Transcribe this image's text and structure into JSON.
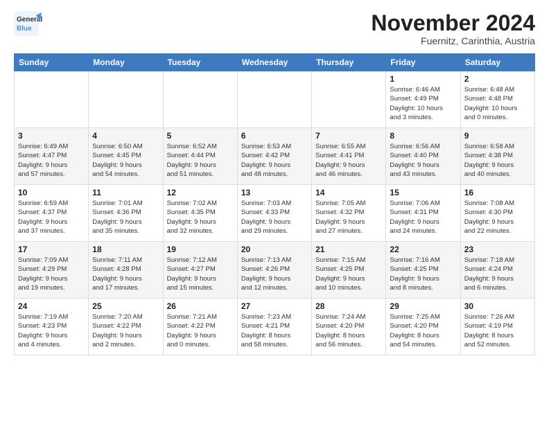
{
  "logo": {
    "text_general": "General",
    "text_blue": "Blue"
  },
  "header": {
    "month": "November 2024",
    "location": "Fuernitz, Carinthia, Austria"
  },
  "weekdays": [
    "Sunday",
    "Monday",
    "Tuesday",
    "Wednesday",
    "Thursday",
    "Friday",
    "Saturday"
  ],
  "weeks": [
    [
      {
        "day": "",
        "info": ""
      },
      {
        "day": "",
        "info": ""
      },
      {
        "day": "",
        "info": ""
      },
      {
        "day": "",
        "info": ""
      },
      {
        "day": "",
        "info": ""
      },
      {
        "day": "1",
        "info": "Sunrise: 6:46 AM\nSunset: 4:49 PM\nDaylight: 10 hours\nand 3 minutes."
      },
      {
        "day": "2",
        "info": "Sunrise: 6:48 AM\nSunset: 4:48 PM\nDaylight: 10 hours\nand 0 minutes."
      }
    ],
    [
      {
        "day": "3",
        "info": "Sunrise: 6:49 AM\nSunset: 4:47 PM\nDaylight: 9 hours\nand 57 minutes."
      },
      {
        "day": "4",
        "info": "Sunrise: 6:50 AM\nSunset: 4:45 PM\nDaylight: 9 hours\nand 54 minutes."
      },
      {
        "day": "5",
        "info": "Sunrise: 6:52 AM\nSunset: 4:44 PM\nDaylight: 9 hours\nand 51 minutes."
      },
      {
        "day": "6",
        "info": "Sunrise: 6:53 AM\nSunset: 4:42 PM\nDaylight: 9 hours\nand 48 minutes."
      },
      {
        "day": "7",
        "info": "Sunrise: 6:55 AM\nSunset: 4:41 PM\nDaylight: 9 hours\nand 46 minutes."
      },
      {
        "day": "8",
        "info": "Sunrise: 6:56 AM\nSunset: 4:40 PM\nDaylight: 9 hours\nand 43 minutes."
      },
      {
        "day": "9",
        "info": "Sunrise: 6:58 AM\nSunset: 4:38 PM\nDaylight: 9 hours\nand 40 minutes."
      }
    ],
    [
      {
        "day": "10",
        "info": "Sunrise: 6:59 AM\nSunset: 4:37 PM\nDaylight: 9 hours\nand 37 minutes."
      },
      {
        "day": "11",
        "info": "Sunrise: 7:01 AM\nSunset: 4:36 PM\nDaylight: 9 hours\nand 35 minutes."
      },
      {
        "day": "12",
        "info": "Sunrise: 7:02 AM\nSunset: 4:35 PM\nDaylight: 9 hours\nand 32 minutes."
      },
      {
        "day": "13",
        "info": "Sunrise: 7:03 AM\nSunset: 4:33 PM\nDaylight: 9 hours\nand 29 minutes."
      },
      {
        "day": "14",
        "info": "Sunrise: 7:05 AM\nSunset: 4:32 PM\nDaylight: 9 hours\nand 27 minutes."
      },
      {
        "day": "15",
        "info": "Sunrise: 7:06 AM\nSunset: 4:31 PM\nDaylight: 9 hours\nand 24 minutes."
      },
      {
        "day": "16",
        "info": "Sunrise: 7:08 AM\nSunset: 4:30 PM\nDaylight: 9 hours\nand 22 minutes."
      }
    ],
    [
      {
        "day": "17",
        "info": "Sunrise: 7:09 AM\nSunset: 4:29 PM\nDaylight: 9 hours\nand 19 minutes."
      },
      {
        "day": "18",
        "info": "Sunrise: 7:11 AM\nSunset: 4:28 PM\nDaylight: 9 hours\nand 17 minutes."
      },
      {
        "day": "19",
        "info": "Sunrise: 7:12 AM\nSunset: 4:27 PM\nDaylight: 9 hours\nand 15 minutes."
      },
      {
        "day": "20",
        "info": "Sunrise: 7:13 AM\nSunset: 4:26 PM\nDaylight: 9 hours\nand 12 minutes."
      },
      {
        "day": "21",
        "info": "Sunrise: 7:15 AM\nSunset: 4:25 PM\nDaylight: 9 hours\nand 10 minutes."
      },
      {
        "day": "22",
        "info": "Sunrise: 7:16 AM\nSunset: 4:25 PM\nDaylight: 9 hours\nand 8 minutes."
      },
      {
        "day": "23",
        "info": "Sunrise: 7:18 AM\nSunset: 4:24 PM\nDaylight: 9 hours\nand 6 minutes."
      }
    ],
    [
      {
        "day": "24",
        "info": "Sunrise: 7:19 AM\nSunset: 4:23 PM\nDaylight: 9 hours\nand 4 minutes."
      },
      {
        "day": "25",
        "info": "Sunrise: 7:20 AM\nSunset: 4:22 PM\nDaylight: 9 hours\nand 2 minutes."
      },
      {
        "day": "26",
        "info": "Sunrise: 7:21 AM\nSunset: 4:22 PM\nDaylight: 9 hours\nand 0 minutes."
      },
      {
        "day": "27",
        "info": "Sunrise: 7:23 AM\nSunset: 4:21 PM\nDaylight: 8 hours\nand 58 minutes."
      },
      {
        "day": "28",
        "info": "Sunrise: 7:24 AM\nSunset: 4:20 PM\nDaylight: 8 hours\nand 56 minutes."
      },
      {
        "day": "29",
        "info": "Sunrise: 7:25 AM\nSunset: 4:20 PM\nDaylight: 8 hours\nand 54 minutes."
      },
      {
        "day": "30",
        "info": "Sunrise: 7:26 AM\nSunset: 4:19 PM\nDaylight: 8 hours\nand 52 minutes."
      }
    ]
  ]
}
